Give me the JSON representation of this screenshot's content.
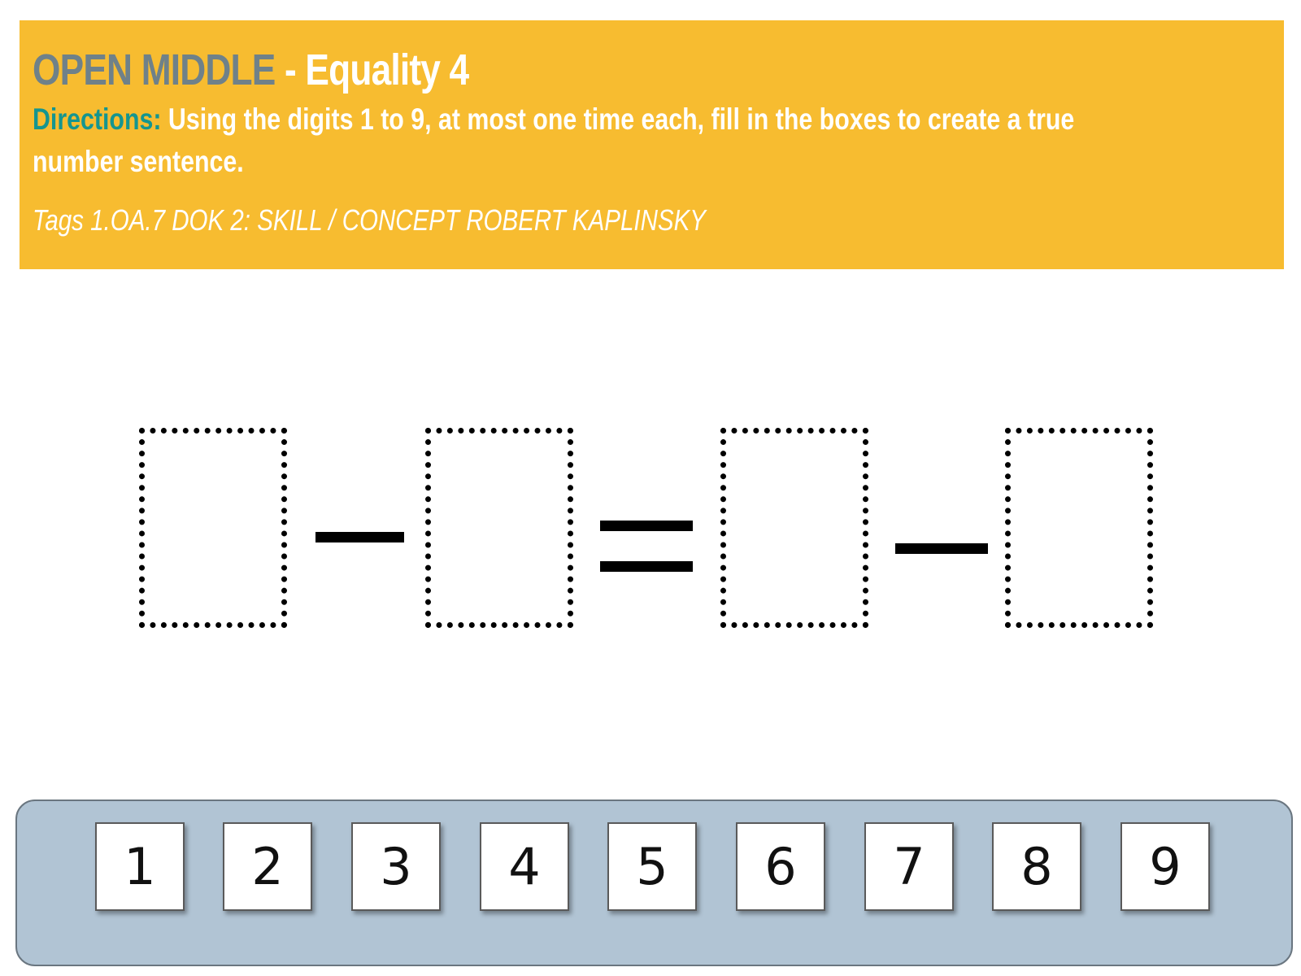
{
  "header": {
    "title_main": "OPEN MIDDLE",
    "title_sub": " - Equality 4",
    "directions_label": "Directions:",
    "directions_text": " Using the digits 1 to 9, at most one time each, fill in the boxes to create a true number sentence.",
    "tags": "Tags 1.OA.7 DOK 2: SKILL / CONCEPT ROBERT KAPLINSKY"
  },
  "equation": {
    "boxes": [
      "",
      "",
      "",
      ""
    ],
    "operators": [
      "minus",
      "equals",
      "minus"
    ]
  },
  "tray": {
    "tiles": [
      "1",
      "2",
      "3",
      "4",
      "5",
      "6",
      "7",
      "8",
      "9"
    ]
  },
  "colors": {
    "header_bg": "#f7bc30",
    "title_main": "#6f8189",
    "directions_label": "#15958f",
    "tray_bg": "#b1c4d4"
  }
}
